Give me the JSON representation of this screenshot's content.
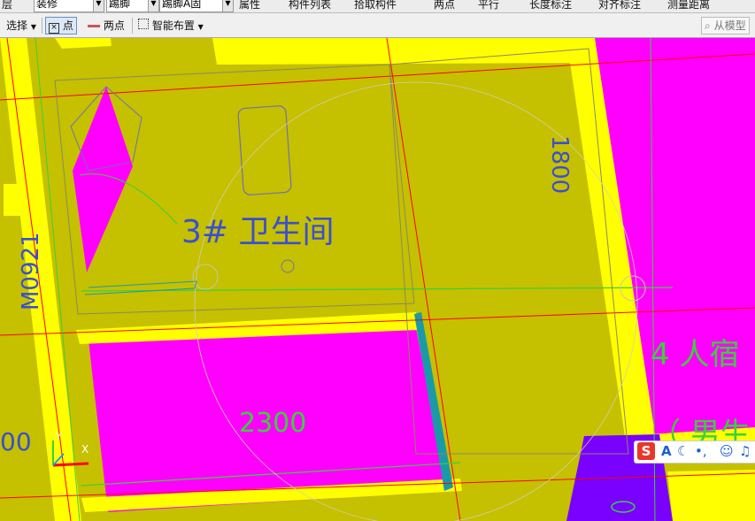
{
  "toolbar_top": {
    "items": [
      "层",
      "装修",
      "踢脚",
      "踢脚A固",
      "属性",
      "构件列表",
      "拾取构件",
      "两点",
      "平行",
      "长度标注",
      "对齐标注",
      "测量距离"
    ]
  },
  "toolbar_main": {
    "select_label": "选择",
    "point_label": "点",
    "two_point_label": "两点",
    "smart_layout_label": "智能布置",
    "from_model_label": "从模型"
  },
  "drawing": {
    "room_label": "3#  卫生间",
    "door_label": "M0921",
    "dim_vertical": "1800",
    "dim_horizontal": "2300",
    "dim_left_partial": "00",
    "dorm_label": "4  人宿",
    "dorm_sub": "（ 男生",
    "axis_x": "X",
    "axis_y": "Y"
  },
  "ime": {
    "logo": "S",
    "mode": "A",
    "icons": [
      "moon-icon",
      "punct-icon",
      "smile-icon",
      "mic-icon"
    ]
  },
  "colors": {
    "floor": "#c5c000",
    "wall": "#ffff00",
    "room_fill": "#ff00ff",
    "dim_green": "#3ad13a",
    "text_blue": "#3a4fd0",
    "axis_red": "#ff0000",
    "column_purple": "#7a00ff",
    "teal_wall": "#1a9aa8"
  }
}
